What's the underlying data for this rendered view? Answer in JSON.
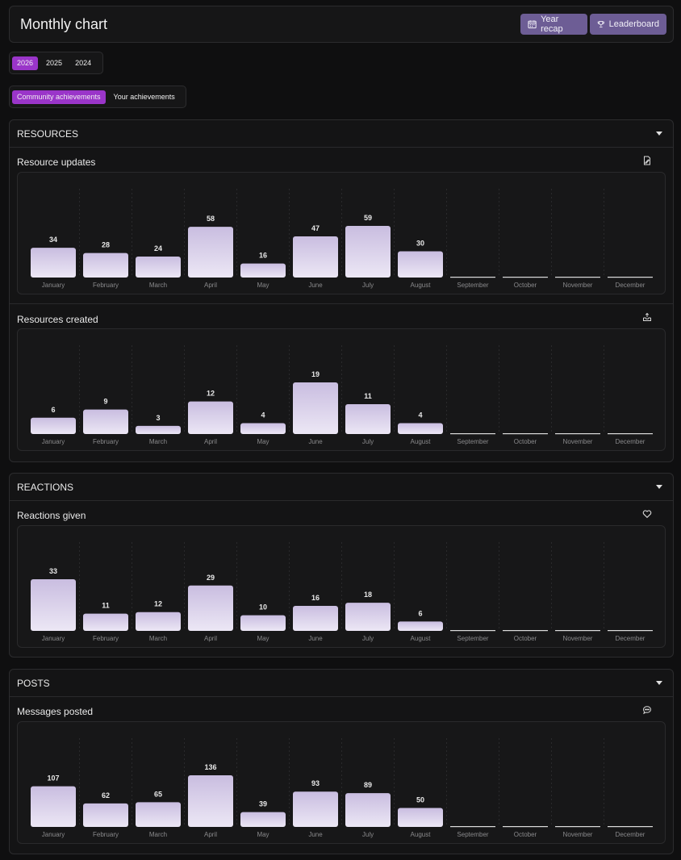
{
  "header": {
    "title": "Monthly chart",
    "year_recap_label": "Year recap",
    "leaderboard_label": "Leaderboard"
  },
  "years": [
    "2026",
    "2025",
    "2024"
  ],
  "selected_year": "2026",
  "modes": [
    "Community achievements",
    "Your achievements"
  ],
  "selected_mode": "Community achievements",
  "months": [
    "January",
    "February",
    "March",
    "April",
    "May",
    "June",
    "July",
    "August",
    "September",
    "October",
    "November",
    "December"
  ],
  "sections": {
    "resources": {
      "title": "RESOURCES",
      "charts": {
        "updates": {
          "title": "Resource updates",
          "icon": "document-edit-icon"
        },
        "created": {
          "title": "Resources created",
          "icon": "upload-tray-icon"
        }
      }
    },
    "reactions": {
      "title": "REACTIONS",
      "charts": {
        "given": {
          "title": "Reactions given",
          "icon": "heart-icon"
        }
      }
    },
    "posts": {
      "title": "POSTS",
      "charts": {
        "messages": {
          "title": "Messages posted",
          "icon": "chat-bubble-icon"
        }
      }
    }
  },
  "chart_data": [
    {
      "type": "bar",
      "title": "Resource updates",
      "categories": [
        "January",
        "February",
        "March",
        "April",
        "May",
        "June",
        "July",
        "August",
        "September",
        "October",
        "November",
        "December"
      ],
      "values": [
        34,
        28,
        24,
        58,
        16,
        47,
        59,
        30,
        null,
        null,
        null,
        null
      ]
    },
    {
      "type": "bar",
      "title": "Resources created",
      "categories": [
        "January",
        "February",
        "March",
        "April",
        "May",
        "June",
        "July",
        "August",
        "September",
        "October",
        "November",
        "December"
      ],
      "values": [
        6,
        9,
        3,
        12,
        4,
        19,
        11,
        4,
        null,
        null,
        null,
        null
      ]
    },
    {
      "type": "bar",
      "title": "Reactions given",
      "categories": [
        "January",
        "February",
        "March",
        "April",
        "May",
        "June",
        "July",
        "August",
        "September",
        "October",
        "November",
        "December"
      ],
      "values": [
        33,
        11,
        12,
        29,
        10,
        16,
        18,
        6,
        null,
        null,
        null,
        null
      ]
    },
    {
      "type": "bar",
      "title": "Messages posted",
      "categories": [
        "January",
        "February",
        "March",
        "April",
        "May",
        "June",
        "July",
        "August",
        "September",
        "October",
        "November",
        "December"
      ],
      "values": [
        107,
        62,
        65,
        136,
        39,
        93,
        89,
        50,
        null,
        null,
        null,
        null
      ]
    }
  ],
  "colors": {
    "accent": "#9a35c9",
    "button": "#6d5d95",
    "bar_top": "#c9bde0",
    "bar_bottom": "#ece7f5"
  }
}
